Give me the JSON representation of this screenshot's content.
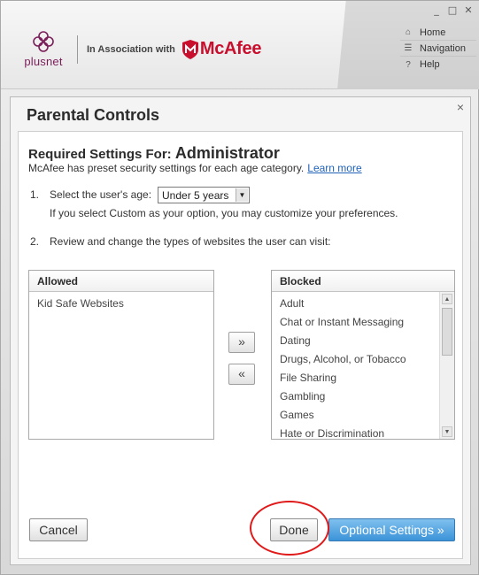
{
  "window": {
    "controls": [
      "_",
      "□",
      "✕"
    ]
  },
  "header": {
    "brand_name": "plusnet",
    "association": "In Association with",
    "partner": "McAfee",
    "nav": [
      {
        "label": "Home",
        "icon": "home-icon"
      },
      {
        "label": "Navigation",
        "icon": "list-icon"
      },
      {
        "label": "Help",
        "icon": "help-icon"
      }
    ]
  },
  "dialog": {
    "title": "Parental Controls",
    "close": "×",
    "required_prefix": "Required Settings For:",
    "user": "Administrator",
    "description": "McAfee has preset security settings for each age category.",
    "learn_more": "Learn more",
    "step1_num": "1.",
    "step1_label": "Select the user's age:",
    "age_value": "Under 5 years",
    "step1_hint": "If you select Custom as your option, you may customize your preferences.",
    "step2_num": "2.",
    "step2_label": "Review and change the types of websites the user can visit:",
    "allowed": {
      "header": "Allowed",
      "items": [
        "Kid Safe Websites"
      ]
    },
    "blocked": {
      "header": "Blocked",
      "items": [
        "Adult",
        "Chat or Instant Messaging",
        "Dating",
        "Drugs, Alcohol, or Tobacco",
        "File Sharing",
        "Gambling",
        "Games",
        "Hate or Discrimination"
      ]
    },
    "move_right": "»",
    "move_left": "«",
    "cancel": "Cancel",
    "done": "Done",
    "optional": "Optional Settings »"
  },
  "colors": {
    "brand": "#7a1e5a",
    "mcafee_red": "#c8102e",
    "link": "#1f62b8",
    "primary_button": "#3b93d8",
    "annotation_ring": "#e01a1a"
  }
}
